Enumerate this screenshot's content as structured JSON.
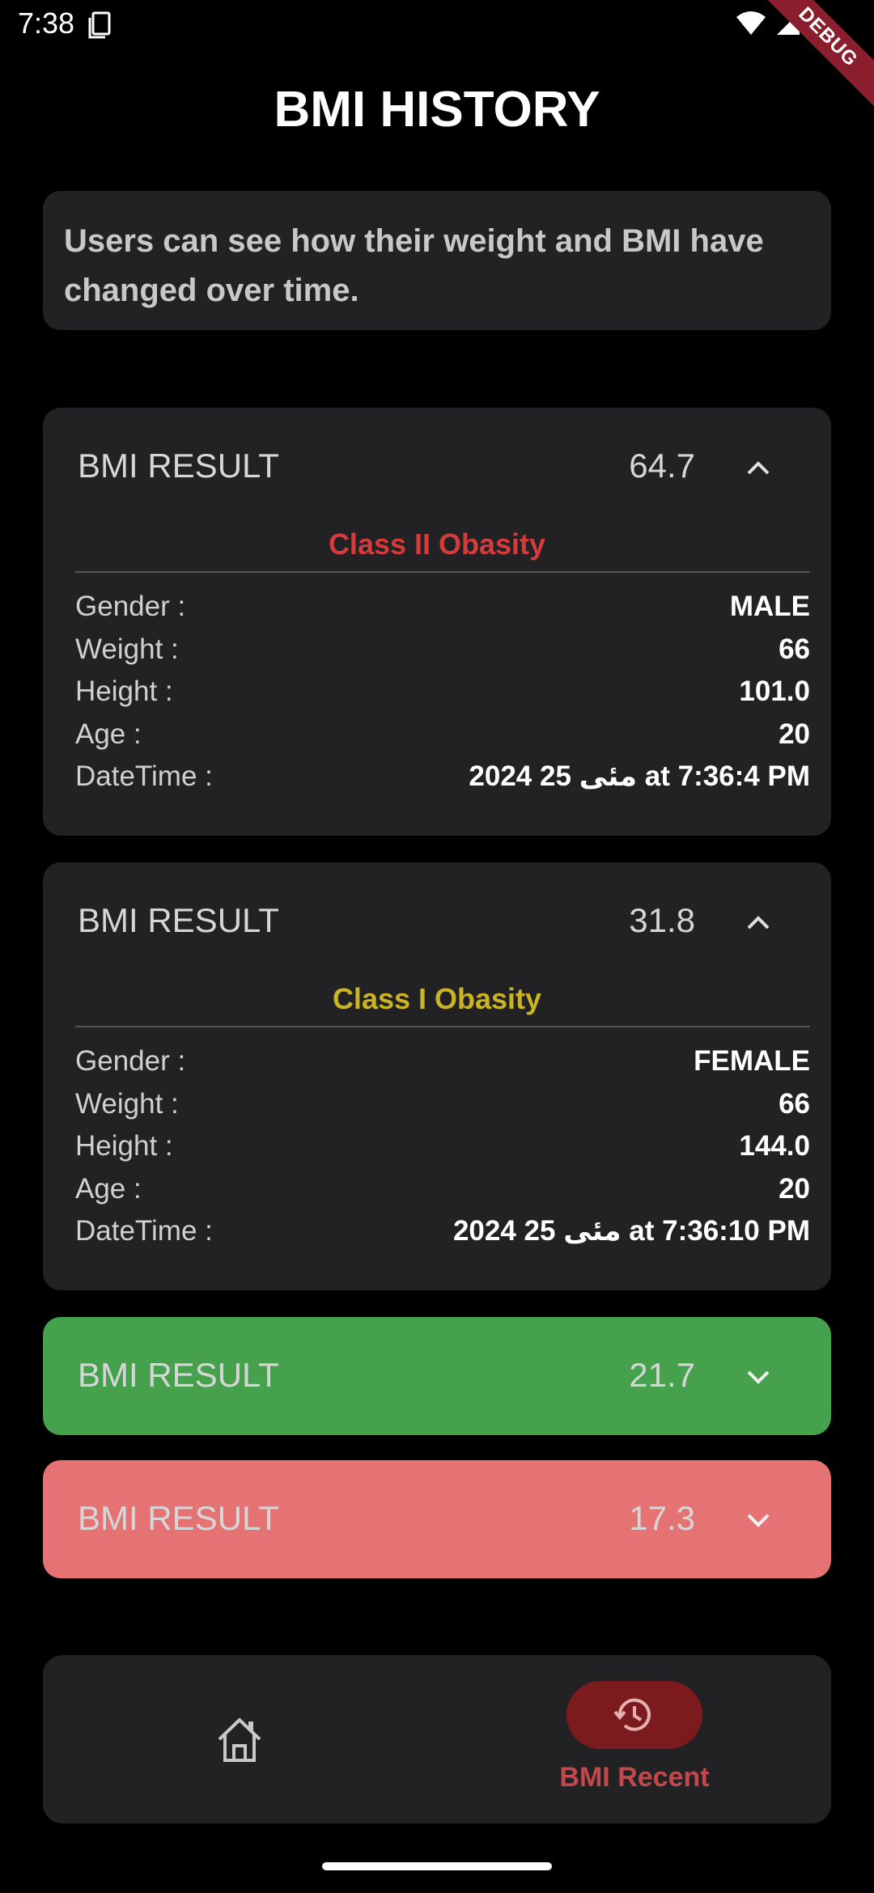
{
  "status_bar": {
    "time": "7:38",
    "debug_label": "DEBUG"
  },
  "header": {
    "title": "BMI HISTORY"
  },
  "info": {
    "text": "Users can see how their weight and BMI have changed over time."
  },
  "results": [
    {
      "label": "BMI RESULT",
      "value": "64.7",
      "expanded": true,
      "class_label": "Class II Obasity",
      "class_color": "#d63b3b",
      "background": "#222224",
      "rows": [
        {
          "key": "Gender :",
          "value": "MALE"
        },
        {
          "key": "Weight :",
          "value": "66"
        },
        {
          "key": "Height :",
          "value": "101.0"
        },
        {
          "key": "Age :",
          "value": "20"
        },
        {
          "key": "DateTime :",
          "value": "2024 25 مئی at 7:36:4 PM"
        }
      ]
    },
    {
      "label": "BMI RESULT",
      "value": "31.8",
      "expanded": true,
      "class_label": "Class I Obasity",
      "class_color": "#c9b523",
      "background": "#222224",
      "rows": [
        {
          "key": "Gender :",
          "value": "FEMALE"
        },
        {
          "key": "Weight :",
          "value": "66"
        },
        {
          "key": "Height :",
          "value": "144.0"
        },
        {
          "key": "Age :",
          "value": "20"
        },
        {
          "key": "DateTime :",
          "value": "2024 25 مئی at 7:36:10 PM"
        }
      ]
    },
    {
      "label": "BMI RESULT",
      "value": "21.7",
      "expanded": false,
      "background": "#45a14b"
    },
    {
      "label": "BMI RESULT",
      "value": "17.3",
      "expanded": false,
      "background": "#e57373"
    }
  ],
  "bottom_nav": {
    "home_icon": "home-icon",
    "history_icon": "history-icon",
    "active_label": "BMI Recent",
    "accent": "#c3484d"
  }
}
